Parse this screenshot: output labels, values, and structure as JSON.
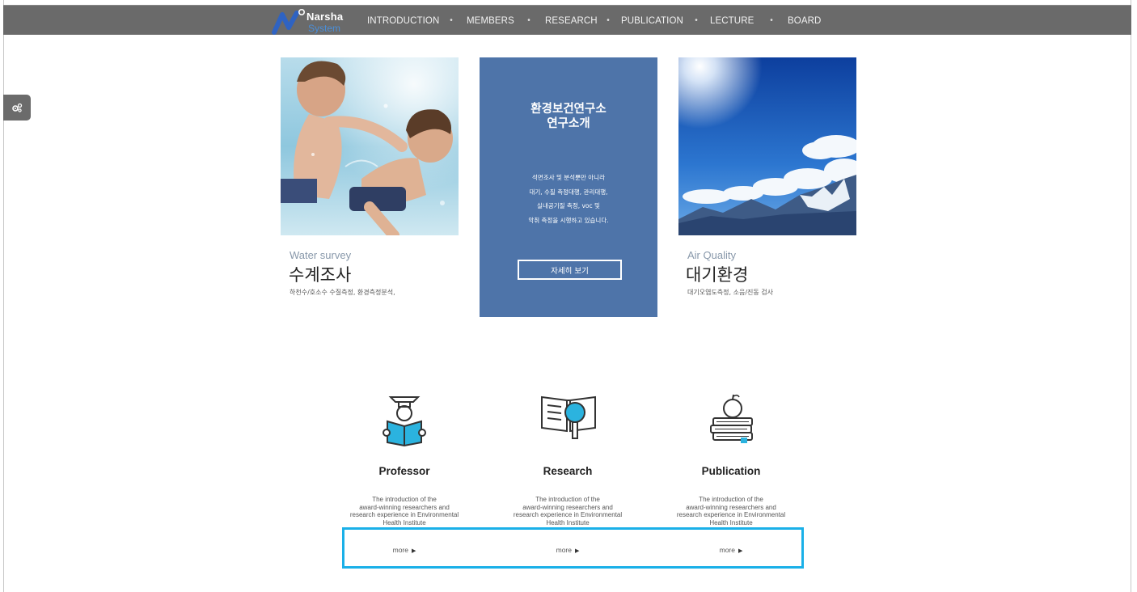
{
  "nav": {
    "logo_word1": "Narsha",
    "logo_word2": "System",
    "items": [
      "INTRODUCTION",
      "MEMBERS",
      "RESEARCH",
      "PUBLICATION",
      "LECTURE",
      "BOARD"
    ],
    "separator": "•",
    "background": "#6a6a6a"
  },
  "side_tab": {
    "icon": "gears-icon"
  },
  "cards": {
    "water": {
      "image": "children-swimming-underwater",
      "title_en": "Water survey",
      "title_ko": "수계조사",
      "subtitle": "하천수/호소수 수질측정, 환경측정분석,"
    },
    "center": {
      "title_line1": "환경보건연구소",
      "title_line2": "연구소개",
      "desc_lines": [
        "석면조사 및 분석뿐만 아니라",
        "대기, 수질 측정대행, 관리대행,",
        "실내공기질 측정, voc 및",
        "악취 측정을 시행하고 있습니다."
      ],
      "button_label": "자세히 보기",
      "background": "#4e74a9"
    },
    "air": {
      "image": "blue-sky-mountains",
      "title_en": "Air Quality",
      "title_ko": "대기환경",
      "subtitle": "대기오염도측정, 소음/진동 검사"
    }
  },
  "features": [
    {
      "icon": "professor-reading-icon",
      "title": "Professor",
      "desc_lines": [
        "The introduction of the",
        "award-winning researchers and",
        "research experience in Environmental",
        "Health Institute"
      ],
      "more": "more"
    },
    {
      "icon": "book-magnifier-icon",
      "title": "Research",
      "desc_lines": [
        "The introduction of the",
        "award-winning researchers and",
        "research experience in Environmental",
        "Health Institute"
      ],
      "more": "more"
    },
    {
      "icon": "books-apple-icon",
      "title": "Publication",
      "desc_lines": [
        "The introduction of the",
        "award-winning researchers and",
        "research experience in Environmental",
        "Health Institute"
      ],
      "more": "more"
    }
  ],
  "colors": {
    "accent": "#1ab0e8",
    "icon_fill": "#2bb3df"
  }
}
